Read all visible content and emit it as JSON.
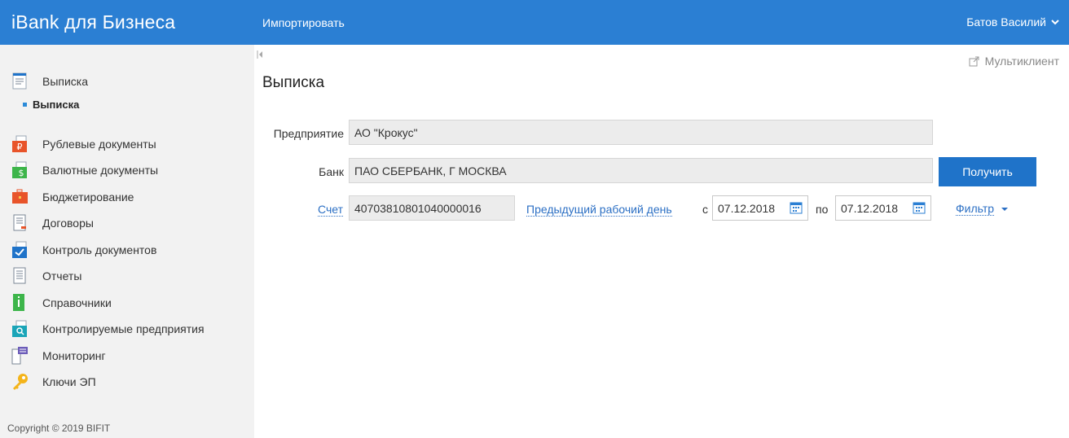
{
  "header": {
    "brand": "iBank для Бизнеса",
    "import_label": "Импортировать",
    "user_name": "Батов Василий"
  },
  "sidebar": {
    "items": [
      {
        "label": "Выписка",
        "icon": "statement-icon"
      },
      {
        "label": "Рублевые документы",
        "icon": "ruble-documents-icon"
      },
      {
        "label": "Валютные документы",
        "icon": "currency-documents-icon"
      },
      {
        "label": "Бюджетирование",
        "icon": "budgeting-icon"
      },
      {
        "label": "Договоры",
        "icon": "contracts-icon"
      },
      {
        "label": "Контроль документов",
        "icon": "document-control-icon"
      },
      {
        "label": "Отчеты",
        "icon": "reports-icon"
      },
      {
        "label": "Справочники",
        "icon": "directories-icon"
      },
      {
        "label": "Контролируемые предприятия",
        "icon": "controlled-companies-icon"
      },
      {
        "label": "Мониторинг",
        "icon": "monitoring-icon"
      },
      {
        "label": "Ключи ЭП",
        "icon": "key-icon"
      }
    ],
    "sub_item": "Выписка",
    "copyright": "Copyright © 2019 BIFIT"
  },
  "main": {
    "multiclient_label": "Мультиклиент",
    "title": "Выписка",
    "company_label": "Предприятие",
    "company_value": "АО \"Крокус\"",
    "bank_label": "Банк",
    "bank_value": "ПАО СБЕРБАНК, Г МОСКВА",
    "get_button": "Получить",
    "account_label": "Счет",
    "account_value": "40703810801040000016",
    "prev_day_link": "Предыдущий рабочий день",
    "from_label": "с",
    "from_date": "07.12.2018",
    "to_label": "по",
    "to_date": "07.12.2018",
    "filter_label": "Фильтр"
  },
  "colors": {
    "header": "#2b7fd3",
    "button": "#1f73c9",
    "link": "#2b6fc4",
    "sidebar_bg": "#f2f2f2"
  }
}
